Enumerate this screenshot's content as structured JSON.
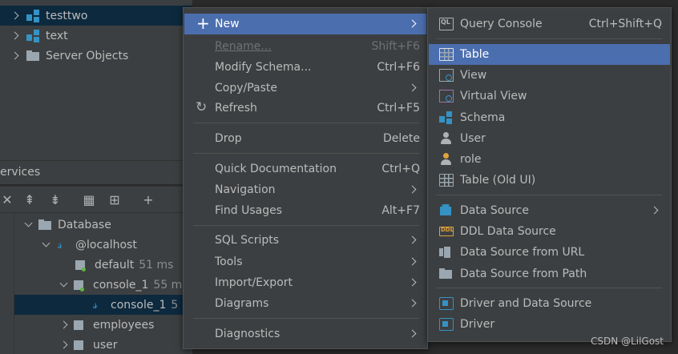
{
  "project_tree": {
    "items": [
      {
        "label": "testtwo",
        "selected": true
      },
      {
        "label": "text",
        "selected": false
      },
      {
        "label": "Server Objects",
        "selected": false
      }
    ]
  },
  "services": {
    "title": "ervices",
    "tree": [
      {
        "label": "Database"
      },
      {
        "label": "@localhost"
      },
      {
        "label": "default",
        "time": "51 ms"
      },
      {
        "label": "console_1",
        "time": "55 m"
      },
      {
        "label": "console_1",
        "time": "5"
      },
      {
        "label": "employees"
      },
      {
        "label": "user"
      }
    ]
  },
  "context_menu": {
    "items": [
      {
        "label": "New",
        "shortcut": "",
        "has_submenu": true,
        "active": true,
        "icon": "plus-icon"
      },
      {
        "label": "Rename...",
        "shortcut": "Shift+F6",
        "disabled": true
      },
      {
        "label": "Modify Schema...",
        "shortcut": "Ctrl+F6"
      },
      {
        "label": "Copy/Paste",
        "shortcut": "",
        "has_submenu": true
      },
      {
        "label": "Refresh",
        "shortcut": "Ctrl+F5",
        "icon": "refresh-icon"
      },
      {
        "label": "Drop",
        "shortcut": "Delete"
      },
      {
        "label": "Quick Documentation",
        "shortcut": "Ctrl+Q"
      },
      {
        "label": "Navigation",
        "shortcut": "",
        "has_submenu": true
      },
      {
        "label": "Find Usages",
        "shortcut": "Alt+F7"
      },
      {
        "label": "SQL Scripts",
        "shortcut": "",
        "has_submenu": true
      },
      {
        "label": "Tools",
        "shortcut": "",
        "has_submenu": true
      },
      {
        "label": "Import/Export",
        "shortcut": "",
        "has_submenu": true
      },
      {
        "label": "Diagrams",
        "shortcut": "",
        "has_submenu": true
      },
      {
        "label": "Diagnostics",
        "shortcut": "",
        "has_submenu": true
      }
    ]
  },
  "new_submenu": {
    "items": [
      {
        "label": "Query Console",
        "shortcut": "Ctrl+Shift+Q",
        "icon": "query-console-icon"
      },
      {
        "label": "Table",
        "shortcut": "",
        "active": true,
        "icon": "table-icon"
      },
      {
        "label": "View",
        "shortcut": "",
        "icon": "view-icon"
      },
      {
        "label": "Virtual View",
        "shortcut": "",
        "icon": "virtual-view-icon"
      },
      {
        "label": "Schema",
        "shortcut": "",
        "icon": "schema-icon"
      },
      {
        "label": "User",
        "shortcut": "",
        "icon": "user-icon"
      },
      {
        "label": "role",
        "shortcut": "",
        "icon": "role-icon"
      },
      {
        "label": "Table (Old UI)",
        "shortcut": "",
        "icon": "table-icon"
      },
      {
        "label": "Data Source",
        "shortcut": "",
        "has_submenu": true,
        "icon": "data-source-icon"
      },
      {
        "label": "DDL Data Source",
        "shortcut": "",
        "icon": "ddl-icon"
      },
      {
        "label": "Data Source from URL",
        "shortcut": "",
        "icon": "plug-icon"
      },
      {
        "label": "Data Source from Path",
        "shortcut": "",
        "icon": "folder-icon"
      },
      {
        "label": "Driver and Data Source",
        "shortcut": "",
        "icon": "driver-icon"
      },
      {
        "label": "Driver",
        "shortcut": "",
        "icon": "driver-icon"
      }
    ]
  },
  "watermark": "CSDN @LilGost",
  "colors": {
    "menu_bg": "#3c3f41",
    "highlight": "#4b6eaf",
    "tree_selected": "#0d293e",
    "accent_blue": "#3592c4"
  }
}
